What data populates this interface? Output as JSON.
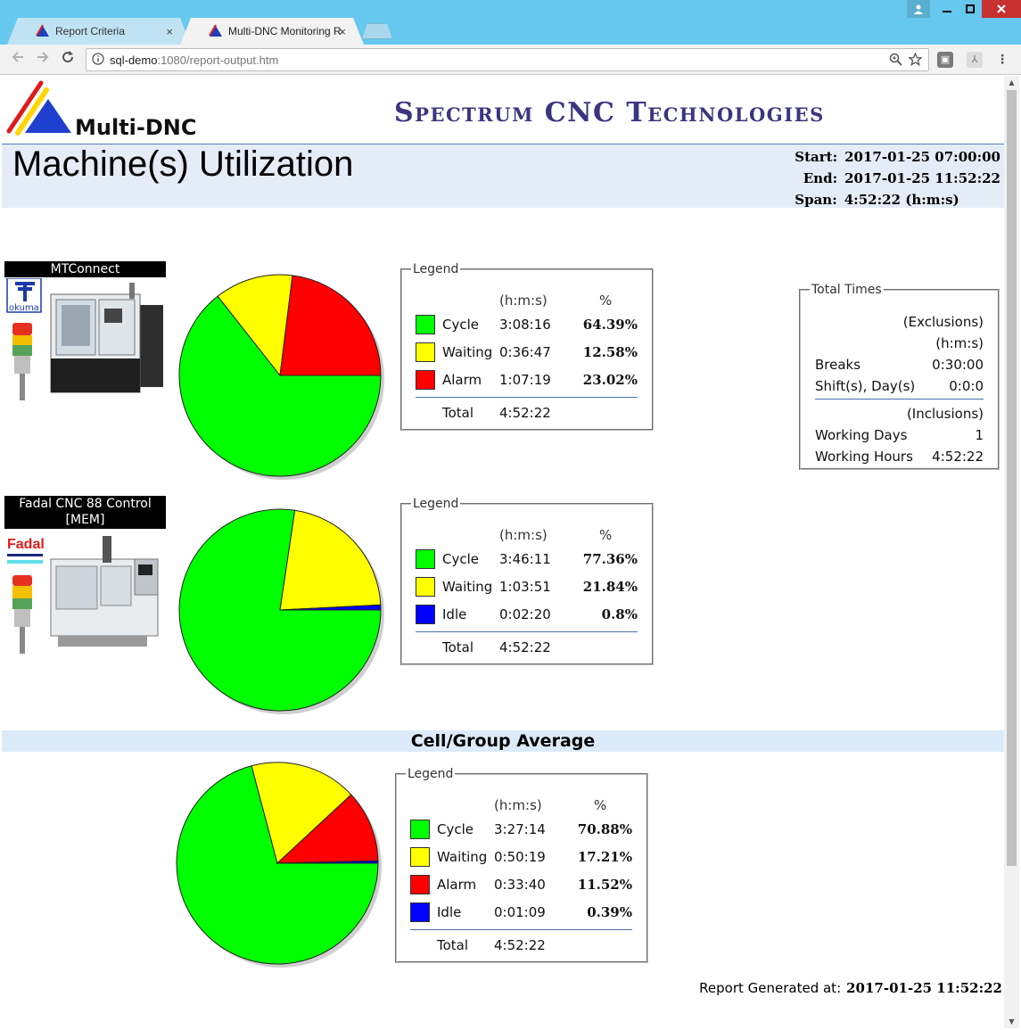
{
  "browser": {
    "tabs": [
      {
        "label": "Report Criteria",
        "close": "×"
      },
      {
        "label": "Multi-DNC Monitoring Report",
        "close": "×"
      }
    ],
    "url_host": "sql-demo",
    "url_rest": ":1080/report-output.htm"
  },
  "header": {
    "company": "Spectrum CNC Technologies",
    "logo_text": "Multi-DNC",
    "title": "Machine(s) Utilization",
    "start_label": "Start:",
    "start_value": "2017-01-25 07:00:00",
    "end_label": "End:",
    "end_value": "2017-01-25 11:52:22",
    "span_label": "Span:",
    "span_value": "4:52:22 (h:m:s)"
  },
  "machines": [
    {
      "name": "MTConnect",
      "brand": "okuma",
      "legend": {
        "title": "Legend",
        "col_time": "(h:m:s)",
        "col_pct": "%",
        "rows": [
          {
            "label": "Cycle",
            "time": "3:08:16",
            "pct": "64.39%",
            "color": "#00ff00"
          },
          {
            "label": "Waiting",
            "time": "0:36:47",
            "pct": "12.58%",
            "color": "#ffff00"
          },
          {
            "label": "Alarm",
            "time": "1:07:19",
            "pct": "23.02%",
            "color": "#ff0000"
          }
        ],
        "total_label": "Total",
        "total_time": "4:52:22"
      }
    },
    {
      "name": "Fadal CNC 88 Control [MEM]",
      "brand": "Fadal",
      "legend": {
        "title": "Legend",
        "col_time": "(h:m:s)",
        "col_pct": "%",
        "rows": [
          {
            "label": "Cycle",
            "time": "3:46:11",
            "pct": "77.36%",
            "color": "#00ff00"
          },
          {
            "label": "Waiting",
            "time": "1:03:51",
            "pct": "21.84%",
            "color": "#ffff00"
          },
          {
            "label": "Idle",
            "time": "0:02:20",
            "pct": "0.8%",
            "color": "#0000ff"
          }
        ],
        "total_label": "Total",
        "total_time": "4:52:22"
      }
    }
  ],
  "total_times": {
    "title": "Total Times",
    "exclusions": "(Exclusions)",
    "unit": "(h:m:s)",
    "breaks_label": "Breaks",
    "breaks_value": "0:30:00",
    "shift_label": "Shift(s), Day(s)",
    "shift_value": "0:0:0",
    "inclusions": "(Inclusions)",
    "days_label": "Working Days",
    "days_value": "1",
    "hours_label": "Working Hours",
    "hours_value": "4:52:22"
  },
  "group": {
    "title": "Cell/Group Average",
    "legend": {
      "title": "Legend",
      "col_time": "(h:m:s)",
      "col_pct": "%",
      "rows": [
        {
          "label": "Cycle",
          "time": "3:27:14",
          "pct": "70.88%",
          "color": "#00ff00"
        },
        {
          "label": "Waiting",
          "time": "0:50:19",
          "pct": "17.21%",
          "color": "#ffff00"
        },
        {
          "label": "Alarm",
          "time": "0:33:40",
          "pct": "11.52%",
          "color": "#ff0000"
        },
        {
          "label": "Idle",
          "time": "0:01:09",
          "pct": "0.39%",
          "color": "#0000ff"
        }
      ],
      "total_label": "Total",
      "total_time": "4:52:22"
    }
  },
  "footer": {
    "generated_label": "Report Generated at:",
    "generated_value": "2017-01-25 11:52:22"
  },
  "chart_data": [
    {
      "type": "pie",
      "categories": [
        "Cycle",
        "Waiting",
        "Alarm"
      ],
      "values": [
        64.39,
        12.58,
        23.02
      ],
      "colors": [
        "#00ff00",
        "#ffff00",
        "#ff0000"
      ]
    },
    {
      "type": "pie",
      "categories": [
        "Cycle",
        "Waiting",
        "Idle"
      ],
      "values": [
        77.36,
        21.84,
        0.8
      ],
      "colors": [
        "#00ff00",
        "#ffff00",
        "#0000ff"
      ]
    },
    {
      "type": "pie",
      "categories": [
        "Cycle",
        "Waiting",
        "Alarm",
        "Idle"
      ],
      "values": [
        70.88,
        17.21,
        11.52,
        0.39
      ],
      "colors": [
        "#00ff00",
        "#ffff00",
        "#ff0000",
        "#0000ff"
      ]
    }
  ]
}
